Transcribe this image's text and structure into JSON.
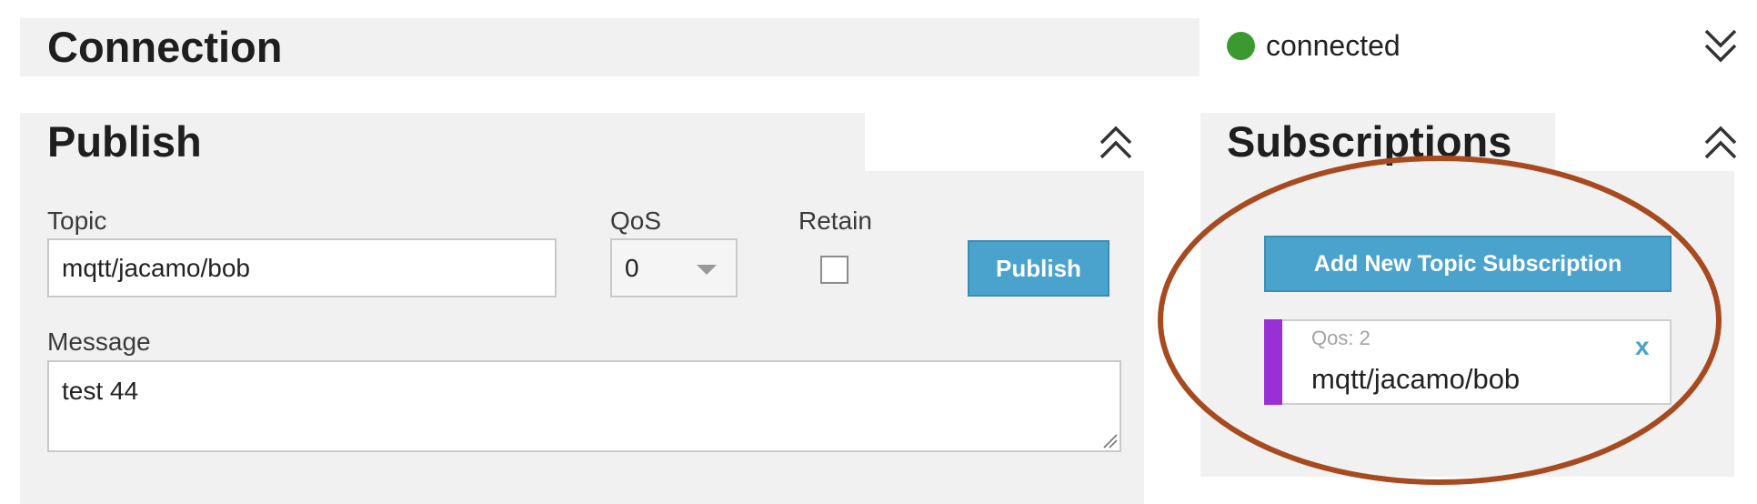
{
  "connection": {
    "title": "Connection",
    "status_text": "connected",
    "status_color": "#3b9a2f",
    "toggle_icon": "double-chevron-down-icon"
  },
  "publish": {
    "title": "Publish",
    "toggle_icon": "double-chevron-up-icon",
    "topic_label": "Topic",
    "topic_value": "mqtt/jacamo/bob",
    "qos_label": "QoS",
    "qos_value": "0",
    "retain_label": "Retain",
    "retain_checked": false,
    "publish_button": "Publish",
    "message_label": "Message",
    "message_value": "test 44"
  },
  "subscriptions": {
    "title": "Subscriptions",
    "toggle_icon": "double-chevron-up-icon",
    "add_button": "Add New Topic Subscription",
    "items": [
      {
        "qos": "Qos: 2",
        "topic": "mqtt/jacamo/bob",
        "close": "x",
        "color": "#9a2fd6"
      }
    ]
  },
  "colors": {
    "accent": "#4aa3cc",
    "panel": "#f1f1f1",
    "annotation": "#a84a1f"
  }
}
